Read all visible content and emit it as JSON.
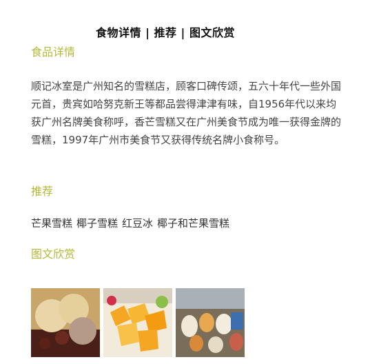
{
  "header": {
    "title": "食物详情 | 推荐 | 图文欣赏"
  },
  "details": {
    "heading": "食品详情",
    "text": "顺记冰室是广州知名的雪糕店，顾客口碑传颂，五六十年代一些外国元首，贵宾如哈努克新王等都品尝得津津有味，自1956年代以来均获广州名牌美食称呼，香芒雪糕又在广州美食节成为唯一获得金牌的雪糕，1997年广州市美食节又获得传统名牌小食称号。"
  },
  "recommend": {
    "heading": "推荐",
    "items": [
      "芒果雪糕",
      "椰子雪糕",
      "红豆冰",
      "椰子和芒果雪糕"
    ]
  },
  "gallery": {
    "heading": "图文欣赏",
    "images": [
      {
        "icon": "ice-cream-scoops-photo"
      },
      {
        "icon": "mango-shaved-ice-photo"
      },
      {
        "icon": "ice-cream-display-photo"
      }
    ]
  },
  "colors": {
    "accent": "#b5b83a",
    "text": "#444444"
  }
}
